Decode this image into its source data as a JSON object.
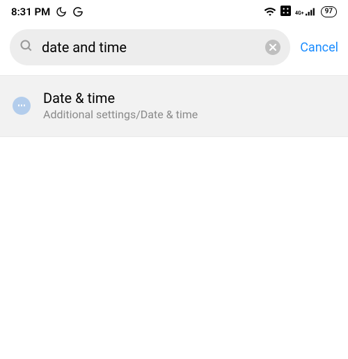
{
  "status_bar": {
    "time": "8:31 PM",
    "battery": "97",
    "signal_label": "4G+"
  },
  "search": {
    "value": "date and time",
    "cancel_label": "Cancel"
  },
  "results": [
    {
      "title": "Date & time",
      "path": "Additional settings/Date & time"
    }
  ]
}
